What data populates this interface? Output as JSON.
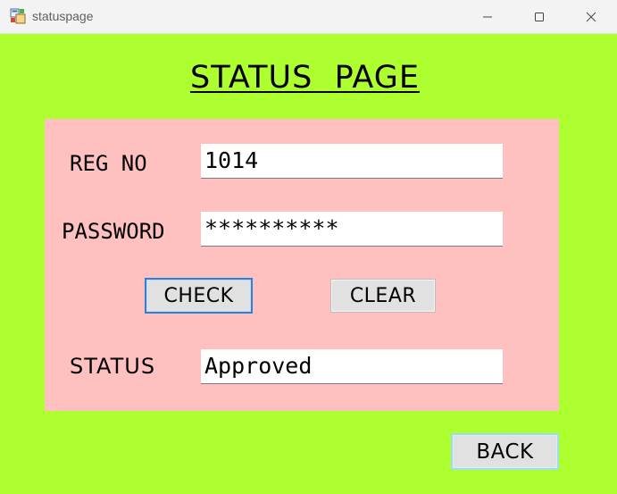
{
  "window": {
    "title": "statuspage",
    "app_icon": "form-app-icon",
    "controls": [
      "minimize-icon",
      "maximize-icon",
      "close-icon"
    ]
  },
  "colors": {
    "background": "#adff2f",
    "panel": "#ffc0c0",
    "field": "#ffffff",
    "button": "#e1e1e1",
    "focus_border": "#2f7fd6"
  },
  "page": {
    "heading": "STATUS  PAGE"
  },
  "form": {
    "reg_no": {
      "label": "REG NO",
      "value": "1014"
    },
    "password": {
      "label": "PASSWORD",
      "value": "**********"
    },
    "status": {
      "label": "STATUS",
      "value": "Approved"
    }
  },
  "buttons": {
    "check": "CHECK",
    "clear": "CLEAR",
    "back": "BACK"
  }
}
